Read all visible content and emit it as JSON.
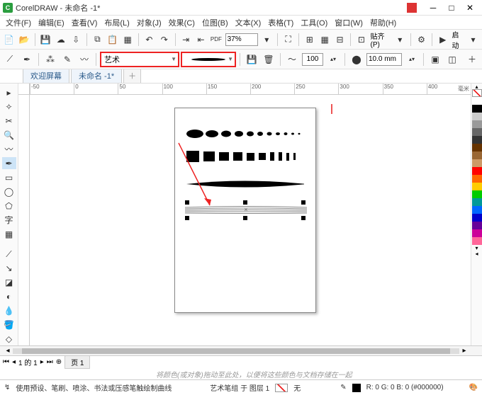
{
  "title": "CorelDRAW - 未命名 -1*",
  "menu": [
    "文件(F)",
    "编辑(E)",
    "查看(V)",
    "布局(L)",
    "对象(J)",
    "效果(C)",
    "位图(B)",
    "文本(X)",
    "表格(T)",
    "工具(O)",
    "窗口(W)",
    "帮助(H)"
  ],
  "toolbar": {
    "zoom": "37%",
    "launch": "启动"
  },
  "propbar": {
    "preset": "艺术",
    "width_val": "100",
    "size_val": "10.0 mm",
    "snap": "贴齐(P)"
  },
  "tabs": {
    "welcome": "欢迎屏幕",
    "doc": "未命名 -1*"
  },
  "ruler": {
    "unit": "毫米",
    "marks": [
      "-50",
      "0",
      "50",
      "100",
      "150",
      "200",
      "250",
      "300",
      "350",
      "400"
    ]
  },
  "pagebar": {
    "nav": "1 的 1",
    "page": "页 1"
  },
  "hint": "将颜色(或对象)拖动至此处，以便将这些颜色与文档存储在一起",
  "status": {
    "left": "使用预设、笔刷、喷涂、书法或压感笔触绘制曲线",
    "mid": "艺术笔组 于 图层 1",
    "fill": "无",
    "rgb": "R: 0 G: 0 B: 0 (#000000)"
  },
  "palette": [
    "#ffffff",
    "#000000",
    "#cccccc",
    "#999999",
    "#666666",
    "#333333",
    "#663300",
    "#996633",
    "#cc9966",
    "#ff0000",
    "#ff6600",
    "#ffcc00",
    "#00cc00",
    "#009999",
    "#0066ff",
    "#0000cc",
    "#660099",
    "#cc0099",
    "#ff6699"
  ]
}
